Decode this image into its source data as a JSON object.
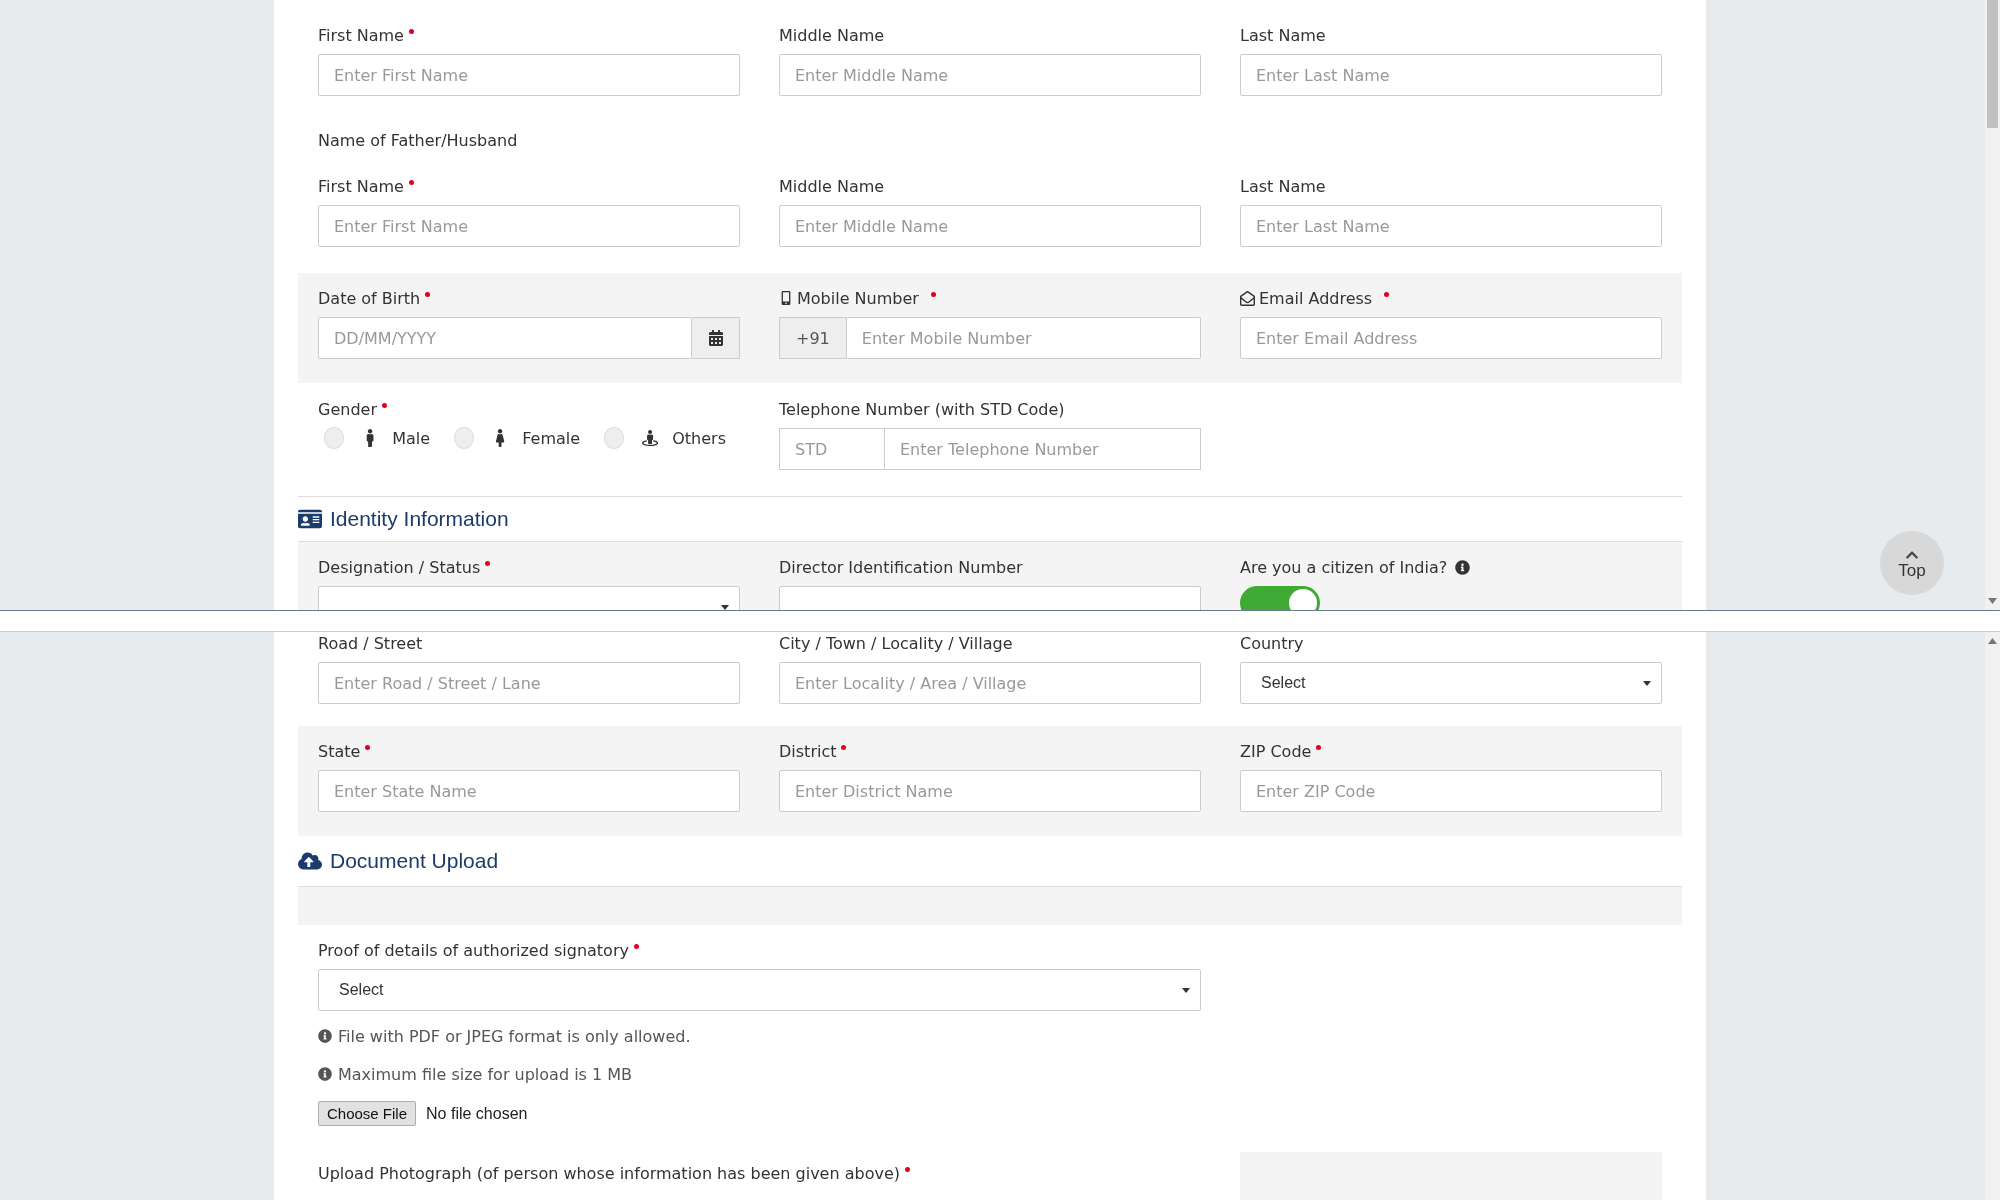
{
  "applicant": {
    "fields": [
      {
        "label": "First Name",
        "required": true,
        "placeholder": "Enter First Name"
      },
      {
        "label": "Middle Name",
        "required": false,
        "placeholder": "Enter Middle Name"
      },
      {
        "label": "Last Name",
        "required": false,
        "placeholder": "Enter Last Name"
      }
    ]
  },
  "father_husband": {
    "heading": "Name of Father/Husband",
    "fields": [
      {
        "label": "First Name",
        "required": true,
        "placeholder": "Enter First Name"
      },
      {
        "label": "Middle Name",
        "required": false,
        "placeholder": "Enter Middle Name"
      },
      {
        "label": "Last Name",
        "required": false,
        "placeholder": "Enter Last Name"
      }
    ]
  },
  "contact_fields": [
    {
      "kind": "date",
      "label": "Date of Birth",
      "required": true,
      "placeholder": "DD/MM/YYYY"
    },
    {
      "kind": "phone",
      "label": "Mobile Number",
      "required": true,
      "prefix": "+91",
      "placeholder": "Enter Mobile Number"
    },
    {
      "kind": "email",
      "label": "Email Address",
      "required": true,
      "placeholder": "Enter Email Address"
    }
  ],
  "gender": {
    "label": "Gender",
    "required": true,
    "options": [
      {
        "label": "Male",
        "selected": false
      },
      {
        "label": "Female",
        "selected": false
      },
      {
        "label": "Others",
        "selected": false
      }
    ]
  },
  "telephone": {
    "label": "Telephone Number (with STD Code)",
    "std_placeholder": "STD",
    "placeholder": "Enter Telephone Number"
  },
  "identity": {
    "title": "Identity Information",
    "fields": [
      {
        "kind": "select",
        "label": "Designation / Status",
        "required": true
      },
      {
        "kind": "text",
        "label": "Director Identification Number",
        "required": false
      },
      {
        "kind": "toggle",
        "label": "Are you a citizen of India?",
        "required": false,
        "on": true
      }
    ]
  },
  "address_fields": [
    {
      "kind": "text",
      "label": "Road / Street",
      "placeholder": "Enter Road / Street / Lane"
    },
    {
      "kind": "text",
      "label": "City / Town / Locality / Village",
      "placeholder": "Enter Locality / Area / Village"
    },
    {
      "kind": "select",
      "label": "Country",
      "value": "Select"
    }
  ],
  "location_fields": [
    {
      "label": "State",
      "required": true,
      "placeholder": "Enter State Name"
    },
    {
      "label": "District",
      "required": true,
      "placeholder": "Enter District Name"
    },
    {
      "label": "ZIP Code",
      "required": true,
      "placeholder": "Enter ZIP Code"
    }
  ],
  "document_upload": {
    "title": "Document Upload",
    "proof": {
      "label": "Proof of details of authorized signatory",
      "required": true,
      "value": "Select"
    },
    "notes": [
      "File with PDF or JPEG format is only allowed.",
      "Maximum file size for upload is 1 MB"
    ],
    "file_button": "Choose File",
    "file_status": "No file chosen",
    "photo": {
      "label": "Upload Photograph (of person whose information has been given above)",
      "required": true
    }
  },
  "top_button": {
    "label": "Top"
  }
}
